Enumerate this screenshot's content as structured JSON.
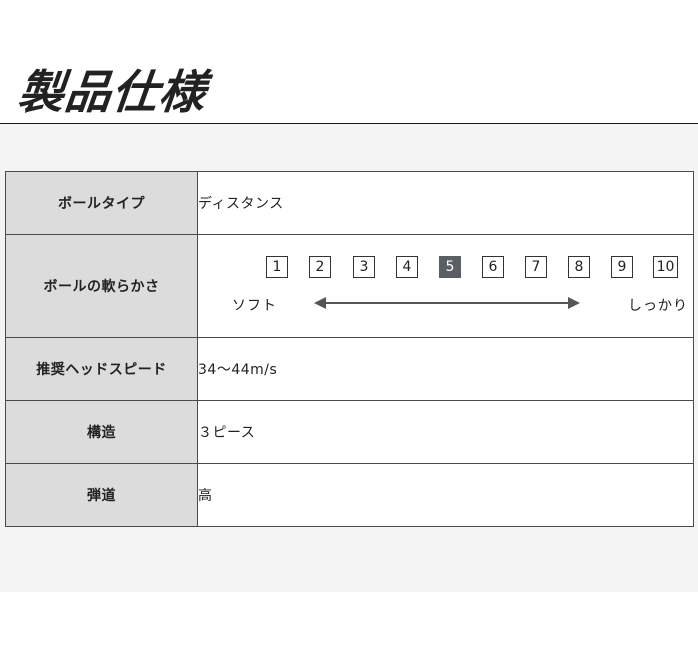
{
  "page": {
    "title": "製品仕様"
  },
  "spec": {
    "rows": [
      {
        "label": "ボールタイプ",
        "value": "ディスタンス"
      },
      {
        "label": "ボールの軟らかさ",
        "value": ""
      },
      {
        "label": "推奨ヘッドスピード",
        "value": "34～44m/s"
      },
      {
        "label": "構造",
        "value": "３ピース"
      },
      {
        "label": "弾道",
        "value": "高"
      }
    ],
    "softness": {
      "levels": [
        "1",
        "2",
        "3",
        "4",
        "5",
        "6",
        "7",
        "8",
        "9",
        "10"
      ],
      "selected": 5,
      "soft_label": "ソフト",
      "hard_label": "しっかり"
    }
  },
  "colors": {
    "label_bg": "#dcdcdc",
    "selected_bg": "#5a5f66",
    "border": "#4a4a4a",
    "area_bg": "#f4f4f4"
  }
}
